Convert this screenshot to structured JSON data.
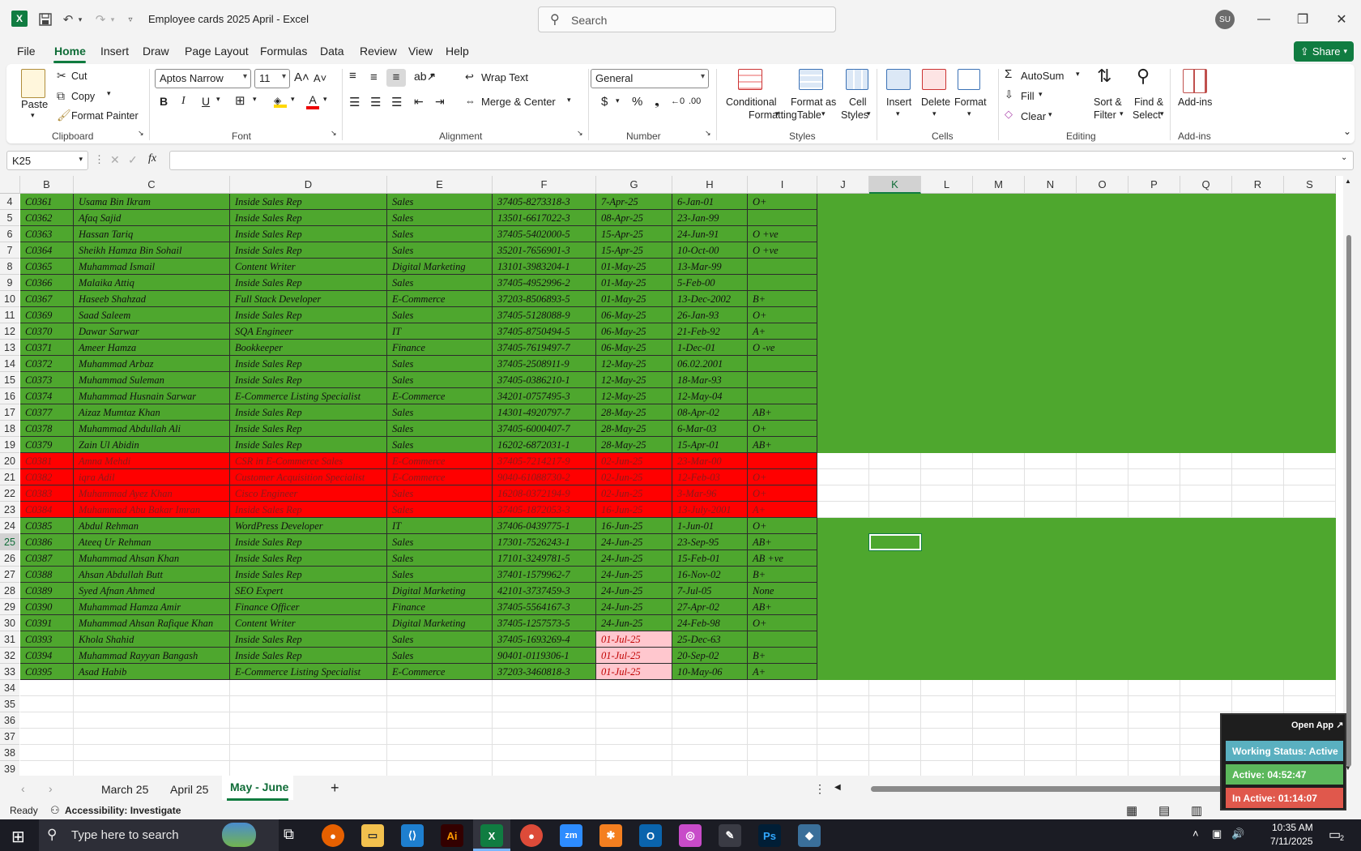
{
  "window": {
    "title": "Employee cards 2025 April  -  Excel",
    "app_icon": "X",
    "avatar": "SU",
    "search_placeholder": "Search"
  },
  "menu": {
    "items": [
      "File",
      "Home",
      "Insert",
      "Draw",
      "Page Layout",
      "Formulas",
      "Data",
      "Review",
      "View",
      "Help"
    ],
    "share_label": "Share"
  },
  "ribbon": {
    "clipboard": {
      "paste": "Paste",
      "cut": "Cut",
      "copy": "Copy",
      "format_painter": "Format Painter",
      "label": "Clipboard"
    },
    "font": {
      "name": "Aptos Narrow",
      "size": "11",
      "label": "Font",
      "bold": "B",
      "italic": "I",
      "underline": "U"
    },
    "alignment": {
      "wrap": "Wrap Text",
      "merge": "Merge & Center",
      "label": "Alignment"
    },
    "number": {
      "format": "General",
      "label": "Number"
    },
    "styles": {
      "cond1": "Conditional",
      "cond2": "Formatting",
      "fat1": "Format as",
      "fat2": "Table",
      "cs1": "Cell",
      "cs2": "Styles",
      "label": "Styles"
    },
    "cells": {
      "insert": "Insert",
      "delete": "Delete",
      "format": "Format",
      "label": "Cells"
    },
    "editing": {
      "autosum": "AutoSum",
      "fill": "Fill",
      "clear": "Clear",
      "sort1": "Sort &",
      "sort2": "Filter",
      "find1": "Find &",
      "find2": "Select",
      "label": "Editing"
    },
    "addins": {
      "btn": "Add-ins",
      "label": "Add-ins"
    }
  },
  "formula_bar": {
    "name_box": "K25",
    "fx": "fx",
    "content": ""
  },
  "colors": {
    "green": "#4ea72e",
    "red": "#ff0000",
    "pink": "#ffc7ce",
    "excel_green": "#107c41"
  },
  "grid": {
    "columns": [
      "B",
      "C",
      "D",
      "E",
      "F",
      "G",
      "H",
      "I",
      "J",
      "K",
      "L",
      "M",
      "N",
      "O",
      "P",
      "Q",
      "R",
      "S"
    ],
    "rows": [
      {
        "n": "4",
        "fill": "green",
        "cells": [
          "C0361",
          "Usama Bin Ikram",
          "Inside Sales Rep",
          "Sales",
          "37405-8273318-3",
          "7-Apr-25",
          "6-Jan-01",
          "O+"
        ]
      },
      {
        "n": "5",
        "fill": "green",
        "cells": [
          "C0362",
          "Afaq Sajid",
          "Inside Sales Rep",
          "Sales",
          "13501-6617022-3",
          "08-Apr-25",
          "23-Jan-99",
          ""
        ]
      },
      {
        "n": "6",
        "fill": "green",
        "cells": [
          "C0363",
          "Hassan Tariq",
          "Inside Sales Rep",
          "Sales",
          "37405-5402000-5",
          "15-Apr-25",
          "24-Jun-91",
          "O +ve"
        ]
      },
      {
        "n": "7",
        "fill": "green",
        "cells": [
          "C0364",
          "Sheikh Hamza Bin Sohail",
          "Inside Sales Rep",
          "Sales",
          "35201-7656901-3",
          "15-Apr-25",
          "10-Oct-00",
          "O +ve"
        ]
      },
      {
        "n": "8",
        "fill": "green",
        "cells": [
          "C0365",
          "Muhammad Ismail",
          "Content Writer",
          "Digital Marketing",
          "13101-3983204-1",
          "01-May-25",
          "13-Mar-99",
          ""
        ]
      },
      {
        "n": "9",
        "fill": "green",
        "cells": [
          "C0366",
          "Malaika Attiq",
          "Inside Sales Rep",
          "Sales",
          "37405-4952996-2",
          "01-May-25",
          "5-Feb-00",
          ""
        ]
      },
      {
        "n": "10",
        "fill": "green",
        "cells": [
          "C0367",
          "Haseeb Shahzad",
          "Full Stack Developer",
          "E-Commerce",
          "37203-8506893-5",
          "01-May-25",
          "13-Dec-2002",
          "B+"
        ]
      },
      {
        "n": "11",
        "fill": "green",
        "cells": [
          "C0369",
          "Saad Saleem",
          "Inside Sales Rep",
          "Sales",
          "37405-5128088-9",
          "06-May-25",
          "26-Jan-93",
          "O+"
        ]
      },
      {
        "n": "12",
        "fill": "green",
        "cells": [
          "C0370",
          "Dawar Sarwar",
          "SQA Engineer",
          "IT",
          "37405-8750494-5",
          "06-May-25",
          "21-Feb-92",
          "A+"
        ]
      },
      {
        "n": "13",
        "fill": "green",
        "cells": [
          "C0371",
          "Ameer Hamza",
          "Bookkeeper",
          "Finance",
          "37405-7619497-7",
          "06-May-25",
          "1-Dec-01",
          "O -ve"
        ]
      },
      {
        "n": "14",
        "fill": "green",
        "cells": [
          "C0372",
          "Muhammad Arbaz",
          "Inside Sales Rep",
          "Sales",
          "37405-2508911-9",
          "12-May-25",
          "06.02.2001",
          ""
        ]
      },
      {
        "n": "15",
        "fill": "green",
        "cells": [
          "C0373",
          "Muhammad Suleman",
          "Inside Sales Rep",
          "Sales",
          "37405-0386210-1",
          "12-May-25",
          "18-Mar-93",
          ""
        ]
      },
      {
        "n": "16",
        "fill": "green",
        "cells": [
          "C0374",
          "Muhammad Husnain Sarwar",
          "E-Commerce Listing Specialist",
          "E-Commerce",
          "34201-0757495-3",
          "12-May-25",
          "12-May-04",
          ""
        ]
      },
      {
        "n": "17",
        "fill": "green",
        "cells": [
          "C0377",
          "Aizaz Mumtaz Khan",
          "Inside Sales Rep",
          "Sales",
          "14301-4920797-7",
          "28-May-25",
          "08-Apr-02",
          "AB+"
        ]
      },
      {
        "n": "18",
        "fill": "green",
        "cells": [
          "C0378",
          "Muhammad Abdullah Ali",
          "Inside Sales Rep",
          "Sales",
          "37405-6000407-7",
          "28-May-25",
          "6-Mar-03",
          "O+"
        ]
      },
      {
        "n": "19",
        "fill": "green",
        "cells": [
          "C0379",
          "Zain Ul Abidin",
          "Inside Sales Rep",
          "Sales",
          "16202-6872031-1",
          "28-May-25",
          "15-Apr-01",
          "AB+"
        ]
      },
      {
        "n": "20",
        "fill": "red",
        "cells": [
          "C0381",
          "Amna Mehdi",
          "CSR in E-Commerce Sales",
          "E-Commerce",
          "37405-7214217-9",
          "02-Jun-25",
          "23-Mar-00",
          ""
        ]
      },
      {
        "n": "21",
        "fill": "red",
        "cells": [
          "C0382",
          "iqra Adil",
          "Customer Acquisition Specialist",
          "E-Commerce",
          "9040-61088730-2",
          "02-Jun-25",
          "12-Feb-03",
          "O+"
        ]
      },
      {
        "n": "22",
        "fill": "red",
        "cells": [
          "C0383",
          "Muhammad Ayez Khan",
          "Cisco Engineer",
          "Sales",
          "16208-0372194-9",
          "02-Jun-25",
          "3-Mar-96",
          "O+"
        ]
      },
      {
        "n": "23",
        "fill": "red",
        "cells": [
          "C0384",
          "Muhammad Abu Bakar Imran",
          "Inside Sales Rep",
          "Sales",
          "37405-1872053-3",
          "16-Jun-25",
          "13-July-2001",
          "A+"
        ]
      },
      {
        "n": "24",
        "fill": "green",
        "cells": [
          "C0385",
          "Abdul Rehman",
          "WordPress Developer",
          "IT",
          "37406-0439775-1",
          "16-Jun-25",
          "1-Jun-01",
          "O+"
        ]
      },
      {
        "n": "25",
        "fill": "green",
        "cells": [
          "C0386",
          "Ateeq Ur Rehman",
          "Inside Sales Rep",
          "Sales",
          "17301-7526243-1",
          "24-Jun-25",
          "23-Sep-95",
          "AB+"
        ]
      },
      {
        "n": "26",
        "fill": "green",
        "cells": [
          "C0387",
          "Muhammad Ahsan Khan",
          "Inside Sales Rep",
          "Sales",
          "17101-3249781-5",
          "24-Jun-25",
          "15-Feb-01",
          "AB +ve"
        ]
      },
      {
        "n": "27",
        "fill": "green",
        "cells": [
          "C0388",
          "Ahsan Abdullah Butt",
          "Inside Sales Rep",
          "Sales",
          "37401-1579962-7",
          "24-Jun-25",
          "16-Nov-02",
          "B+"
        ]
      },
      {
        "n": "28",
        "fill": "green",
        "cells": [
          "C0389",
          "Syed Afnan Ahmed",
          "SEO Expert",
          "Digital Marketing",
          "42101-3737459-3",
          "24-Jun-25",
          "7-Jul-05",
          "None"
        ]
      },
      {
        "n": "29",
        "fill": "green",
        "cells": [
          "C0390",
          "Muhammad Hamza Amir",
          "Finance Officer",
          "Finance",
          "37405-5564167-3",
          "24-Jun-25",
          "27-Apr-02",
          "AB+"
        ]
      },
      {
        "n": "30",
        "fill": "green",
        "cells": [
          "C0391",
          "Muhammad Ahsan Rafique Khan",
          "Content Writer",
          "Digital Marketing",
          "37405-1257573-5",
          "24-Jun-25",
          "24-Feb-98",
          "O+"
        ]
      },
      {
        "n": "31",
        "fill": "green",
        "pinkG": true,
        "cells": [
          "C0393",
          "Khola Shahid",
          "Inside Sales Rep",
          "Sales",
          "37405-1693269-4",
          "01-Jul-25",
          "25-Dec-63",
          ""
        ]
      },
      {
        "n": "32",
        "fill": "green",
        "pinkG": true,
        "cells": [
          "C0394",
          "Muhammad Rayyan Bangash",
          "Inside Sales Rep",
          "Sales",
          "90401-0119306-1",
          "01-Jul-25",
          "20-Sep-02",
          "B+"
        ]
      },
      {
        "n": "33",
        "fill": "green",
        "pinkG": true,
        "cells": [
          "C0395",
          "Asad Habib",
          "E-Commerce Listing Specialist",
          "E-Commerce",
          "37203-3460818-3",
          "01-Jul-25",
          "10-May-06",
          "A+"
        ]
      },
      {
        "n": "34",
        "fill": "none",
        "cells": []
      },
      {
        "n": "35",
        "fill": "none",
        "cells": []
      },
      {
        "n": "36",
        "fill": "none",
        "cells": []
      },
      {
        "n": "37",
        "fill": "none",
        "cells": []
      },
      {
        "n": "38",
        "fill": "none",
        "cells": []
      },
      {
        "n": "39",
        "fill": "none",
        "cells": []
      }
    ]
  },
  "sheets": {
    "tabs": [
      "March 25",
      "April 25",
      "May - June"
    ],
    "active": "May - June",
    "add": "+"
  },
  "status": {
    "ready": "Ready",
    "accessibility": "Accessibility: Investigate"
  },
  "overlay": {
    "open_app": "Open App ↗",
    "working": "Working Status: Active",
    "active": "Active: 04:52:47",
    "inactive": "In Active: 01:14:07"
  },
  "taskbar": {
    "search_placeholder": "Type here to search",
    "time": "10:35 AM",
    "date": "7/11/2025",
    "notif": "2"
  }
}
